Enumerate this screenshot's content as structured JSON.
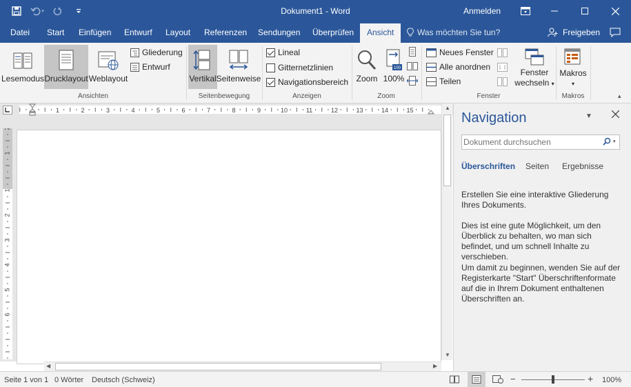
{
  "window": {
    "title": "Dokument1 - Word",
    "sign_in": "Anmelden",
    "accent": "#2b579a"
  },
  "quick_access": {
    "icons": [
      "save-icon",
      "undo-icon",
      "redo-icon",
      "customize-icon"
    ]
  },
  "tabs": [
    {
      "label": "Datei"
    },
    {
      "label": "Start"
    },
    {
      "label": "Einfügen"
    },
    {
      "label": "Entwurf"
    },
    {
      "label": "Layout"
    },
    {
      "label": "Referenzen"
    },
    {
      "label": "Sendungen"
    },
    {
      "label": "Überprüfen"
    },
    {
      "label": "Ansicht",
      "active": true
    }
  ],
  "tell_me": "Was möchten Sie tun?",
  "share_label": "Freigeben",
  "ribbon": {
    "ansichten": {
      "label": "Ansichten",
      "lesemodus": "Lesemodus",
      "drucklayout": "Drucklayout",
      "weblayout": "Weblayout",
      "gliederung": "Gliederung",
      "entwurf": "Entwurf"
    },
    "seitenbewegung": {
      "label": "Seitenbewegung",
      "vertikal": "Vertikal",
      "seitenweise": "Seitenweise"
    },
    "anzeigen": {
      "label": "Anzeigen",
      "lineal": "Lineal",
      "lineal_checked": true,
      "gitternetzlinien": "Gitternetzlinien",
      "gitternetzlinien_checked": false,
      "navigationsbereich": "Navigationsbereich",
      "navigationsbereich_checked": true
    },
    "zoom": {
      "label": "Zoom",
      "zoom": "Zoom",
      "hundred": "100%",
      "icon_badge": "100"
    },
    "fenster": {
      "label": "Fenster",
      "neues_fenster": "Neues Fenster",
      "alle_anordnen": "Alle anordnen",
      "teilen": "Teilen",
      "fenster_wechseln_1": "Fenster",
      "fenster_wechseln_2": "wechseln"
    },
    "makros": {
      "label": "Makros",
      "makros": "Makros"
    }
  },
  "ruler": {
    "h_labels": [
      "1",
      "1",
      "2",
      "3",
      "4",
      "5",
      "6",
      "7",
      "8",
      "9",
      "10",
      "11",
      "12",
      "13",
      "14",
      "15"
    ],
    "v_labels": [
      "2",
      "1",
      "1",
      "2",
      "3",
      "4",
      "5",
      "6"
    ]
  },
  "navigation": {
    "title": "Navigation",
    "search_placeholder": "Dokument durchsuchen",
    "tabs": [
      "Überschriften",
      "Seiten",
      "Ergebnisse"
    ],
    "para1": "Erstellen Sie eine interaktive Gliederung Ihres Dokuments.",
    "para2": "Dies ist eine gute Möglichkeit, um den Überblick zu behalten, wo man sich befindet, und um schnell Inhalte zu verschieben.",
    "para3": "Um damit zu beginnen, wenden Sie auf der Registerkarte \"Start\" Überschriftenformate auf die in Ihrem Dokument enthaltenen Überschriften an."
  },
  "status": {
    "page": "Seite 1 von 1",
    "words": "0 Wörter",
    "language": "Deutsch (Schweiz)",
    "zoom": "100%",
    "zoom_level": 1.0
  }
}
